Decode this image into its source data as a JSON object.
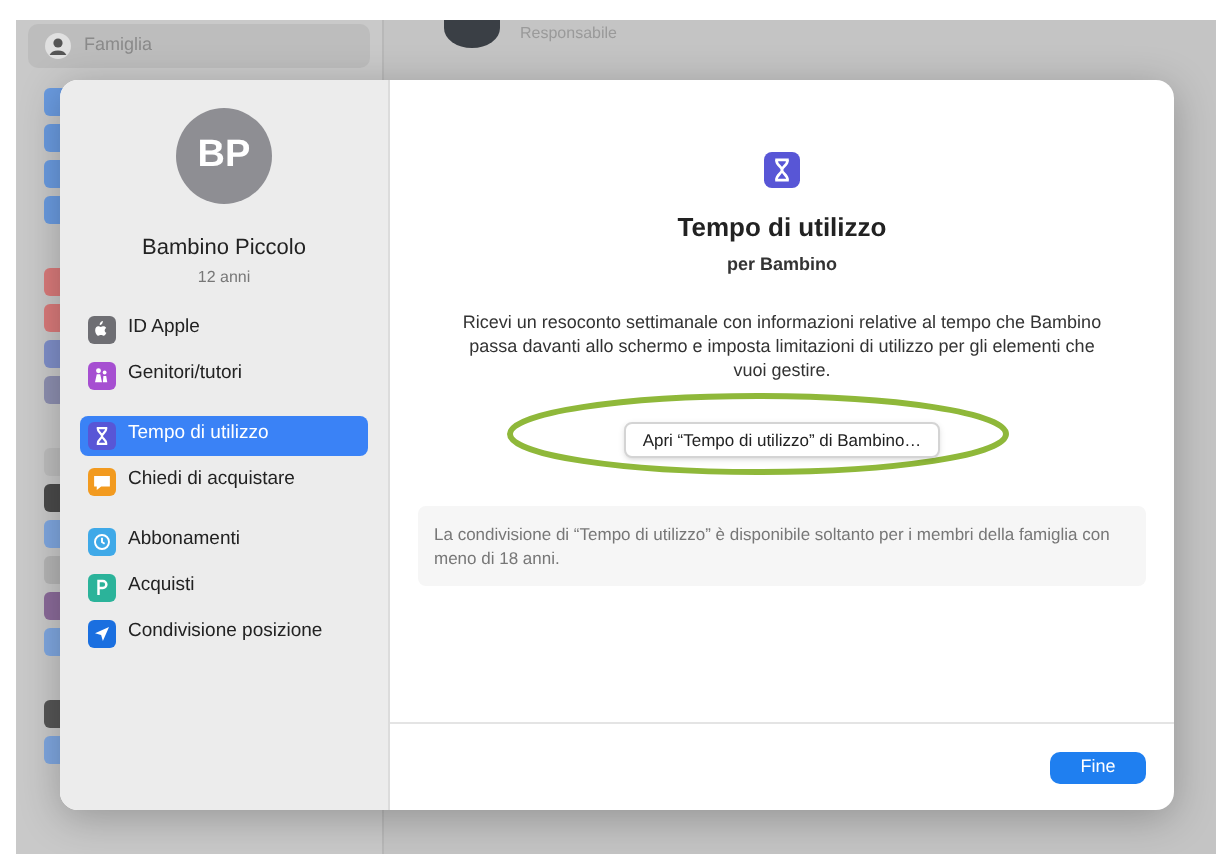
{
  "background": {
    "sidebar_item": "Famiglia",
    "member_role": "Responsabile"
  },
  "dialog": {
    "avatar": "BP",
    "name": "Bambino Piccolo",
    "age": "12 anni",
    "menu": [
      [
        {
          "label": "ID Apple",
          "kind": "apple",
          "color": "#6e6e73",
          "selected": false
        },
        {
          "label": "Genitori/tutori",
          "kind": "people",
          "color": "#a64fd1",
          "selected": false
        }
      ],
      [
        {
          "label": "Tempo di utilizzo",
          "kind": "hourglass",
          "color": "#5856d6",
          "selected": true
        },
        {
          "label": "Chiedi di acquistare",
          "kind": "bubble",
          "color": "#f29a1f",
          "selected": false
        }
      ],
      [
        {
          "label": "Abbonamenti",
          "kind": "clock",
          "color": "#3fa9e8",
          "selected": false
        },
        {
          "label": "Acquisti",
          "kind": "store",
          "color": "#2bb39a",
          "selected": false
        },
        {
          "label": "Condivisione posizione",
          "kind": "location",
          "color": "#1a6fe0",
          "selected": false
        }
      ]
    ],
    "title": "Tempo di utilizzo",
    "subtitle": "per Bambino",
    "description": "Ricevi un resoconto settimanale con informazioni relative al tempo che Bambino passa davanti allo schermo e imposta limitazioni di utilizzo per gli elementi che vuoi gestire.",
    "open_button": "Apri “Tempo di utilizzo” di Bambino…",
    "note": "La condivisione di “Tempo di utilizzo” è disponibile soltanto per i membri della famiglia con meno di 18 anni.",
    "done_button": "Fine"
  },
  "annotation": {
    "kind": "ellipse",
    "color": "#8fb83a"
  }
}
